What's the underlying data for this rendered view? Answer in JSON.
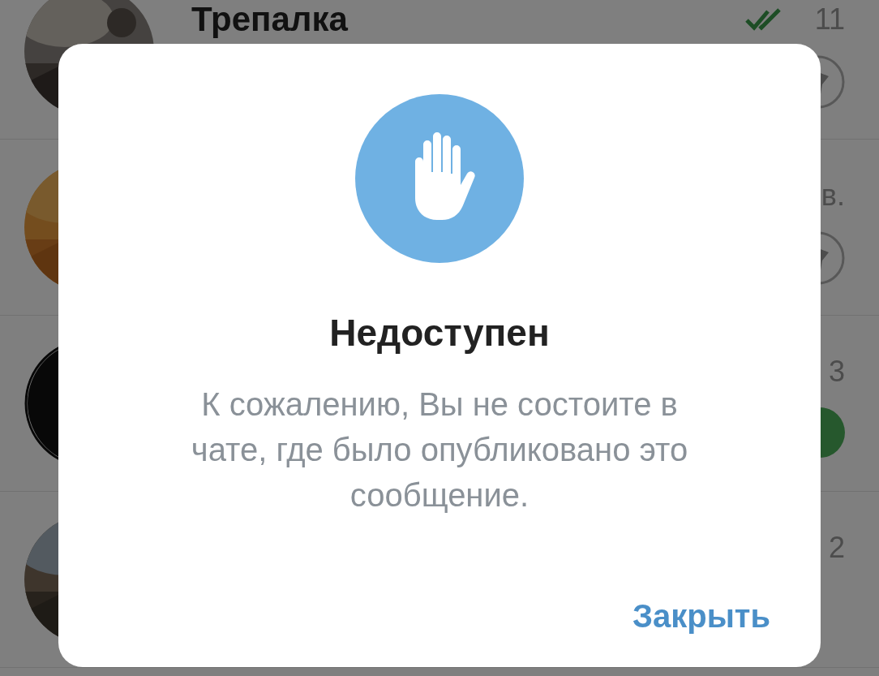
{
  "chat_list": {
    "rows": [
      {
        "name": "Трепалка",
        "time": "11",
        "read": true,
        "pinned": true
      },
      {
        "time": "в.",
        "pinned": true
      },
      {
        "time": "3",
        "unread": true
      },
      {
        "time": "2"
      }
    ]
  },
  "dialog": {
    "title": "Недоступен",
    "message": "К сожалению, Вы не состоите в чате, где было опубликовано это сообщение.",
    "buttons": [
      "Закрыть"
    ]
  }
}
